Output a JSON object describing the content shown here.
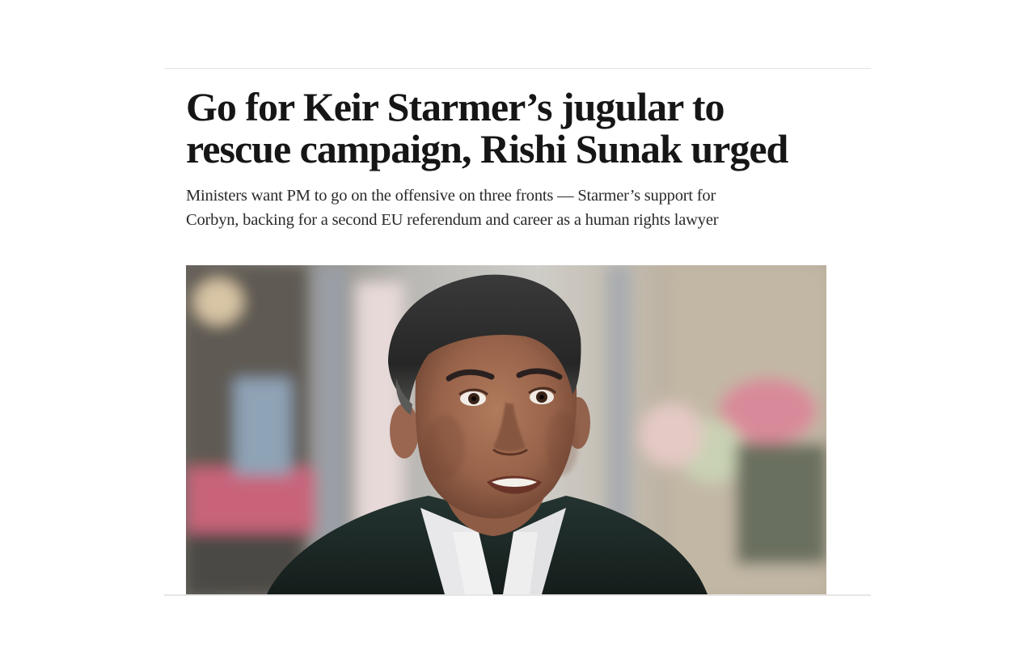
{
  "article": {
    "headline_line1": "Go for Keir Starmer’s jugular to",
    "headline_line2": "rescue campaign, Rishi Sunak urged",
    "standfirst_line1": "Ministers want PM to go on the offensive on three fronts — Starmer’s support for",
    "standfirst_line2": "Corbyn, backing for a second EU referendum and career as a human rights lawyer"
  },
  "photo": {
    "subject": "portrait photo of Rishi Sunak speaking, dark knit jumper over white collared shirt, blurred indoor background"
  },
  "colors": {
    "headline": "#161616",
    "standfirst": "#2a2a2a",
    "rule": "#e3e3e3",
    "jumper": "#1f2a27",
    "background_bokeh_pink": "#c8637a"
  }
}
